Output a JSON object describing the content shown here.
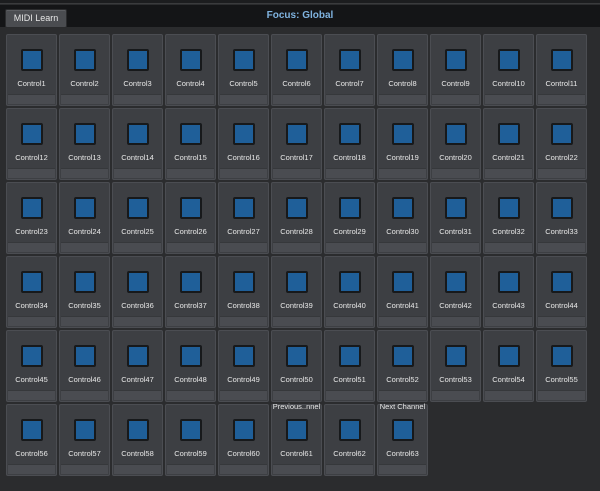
{
  "header": {
    "midi_learn_label": "MIDI Learn",
    "focus_label": "Focus: Global"
  },
  "colors": {
    "pad": "#1f5f99",
    "focus_text": "#7fb3e0",
    "background": "#2b2c2e"
  },
  "controls": [
    {
      "name": "Control1",
      "caption": ""
    },
    {
      "name": "Control2",
      "caption": ""
    },
    {
      "name": "Control3",
      "caption": ""
    },
    {
      "name": "Control4",
      "caption": ""
    },
    {
      "name": "Control5",
      "caption": ""
    },
    {
      "name": "Control6",
      "caption": ""
    },
    {
      "name": "Control7",
      "caption": ""
    },
    {
      "name": "Control8",
      "caption": ""
    },
    {
      "name": "Control9",
      "caption": ""
    },
    {
      "name": "Control10",
      "caption": ""
    },
    {
      "name": "Control11",
      "caption": ""
    },
    {
      "name": "Control12",
      "caption": ""
    },
    {
      "name": "Control13",
      "caption": ""
    },
    {
      "name": "Control14",
      "caption": ""
    },
    {
      "name": "Control15",
      "caption": ""
    },
    {
      "name": "Control16",
      "caption": ""
    },
    {
      "name": "Control17",
      "caption": ""
    },
    {
      "name": "Control18",
      "caption": ""
    },
    {
      "name": "Control19",
      "caption": ""
    },
    {
      "name": "Control20",
      "caption": ""
    },
    {
      "name": "Control21",
      "caption": ""
    },
    {
      "name": "Control22",
      "caption": ""
    },
    {
      "name": "Control23",
      "caption": ""
    },
    {
      "name": "Control24",
      "caption": ""
    },
    {
      "name": "Control25",
      "caption": ""
    },
    {
      "name": "Control26",
      "caption": ""
    },
    {
      "name": "Control27",
      "caption": ""
    },
    {
      "name": "Control28",
      "caption": ""
    },
    {
      "name": "Control29",
      "caption": ""
    },
    {
      "name": "Control30",
      "caption": ""
    },
    {
      "name": "Control31",
      "caption": ""
    },
    {
      "name": "Control32",
      "caption": ""
    },
    {
      "name": "Control33",
      "caption": ""
    },
    {
      "name": "Control34",
      "caption": ""
    },
    {
      "name": "Control35",
      "caption": ""
    },
    {
      "name": "Control36",
      "caption": ""
    },
    {
      "name": "Control37",
      "caption": ""
    },
    {
      "name": "Control38",
      "caption": ""
    },
    {
      "name": "Control39",
      "caption": ""
    },
    {
      "name": "Control40",
      "caption": ""
    },
    {
      "name": "Control41",
      "caption": ""
    },
    {
      "name": "Control42",
      "caption": ""
    },
    {
      "name": "Control43",
      "caption": ""
    },
    {
      "name": "Control44",
      "caption": ""
    },
    {
      "name": "Control45",
      "caption": ""
    },
    {
      "name": "Control46",
      "caption": ""
    },
    {
      "name": "Control47",
      "caption": ""
    },
    {
      "name": "Control48",
      "caption": ""
    },
    {
      "name": "Control49",
      "caption": ""
    },
    {
      "name": "Control50",
      "caption": ""
    },
    {
      "name": "Control51",
      "caption": ""
    },
    {
      "name": "Control52",
      "caption": ""
    },
    {
      "name": "Control53",
      "caption": ""
    },
    {
      "name": "Control54",
      "caption": ""
    },
    {
      "name": "Control55",
      "caption": ""
    },
    {
      "name": "Control56",
      "caption": ""
    },
    {
      "name": "Control57",
      "caption": ""
    },
    {
      "name": "Control58",
      "caption": ""
    },
    {
      "name": "Control59",
      "caption": ""
    },
    {
      "name": "Control60",
      "caption": ""
    },
    {
      "name": "Control61",
      "caption": "Previous..nnel"
    },
    {
      "name": "Control62",
      "caption": ""
    },
    {
      "name": "Control63",
      "caption": "Next Channel"
    }
  ]
}
